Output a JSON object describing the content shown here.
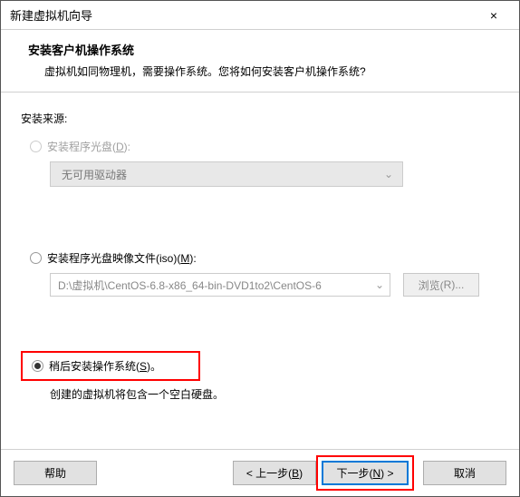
{
  "titlebar": {
    "title": "新建虚拟机向导",
    "close": "×"
  },
  "header": {
    "title": "安装客户机操作系统",
    "subtitle": "虚拟机如同物理机，需要操作系统。您将如何安装客户机操作系统?"
  },
  "source_label": "安装来源:",
  "opt_disc": {
    "label_pre": "安装程序光盘(",
    "hotkey": "D",
    "label_post": "):"
  },
  "dropdown": {
    "text": "无可用驱动器"
  },
  "opt_iso": {
    "label_pre": "安装程序光盘映像文件(iso)(",
    "hotkey": "M",
    "label_post": "):"
  },
  "iso_path": "D:\\虚拟机\\CentOS-6.8-x86_64-bin-DVD1to2\\CentOS-6",
  "browse": {
    "label_pre": "浏览(",
    "hotkey": "R",
    "label_post": ")..."
  },
  "opt_later": {
    "label_pre": "稍后安装操作系统(",
    "hotkey": "S",
    "label_post": ")。"
  },
  "hint": "创建的虚拟机将包含一个空白硬盘。",
  "buttons": {
    "help": "帮助",
    "back_pre": "< 上一步(",
    "back_hot": "B",
    "back_post": ")",
    "next_pre": "下一步(",
    "next_hot": "N",
    "next_post": ") >",
    "cancel": "取消"
  }
}
